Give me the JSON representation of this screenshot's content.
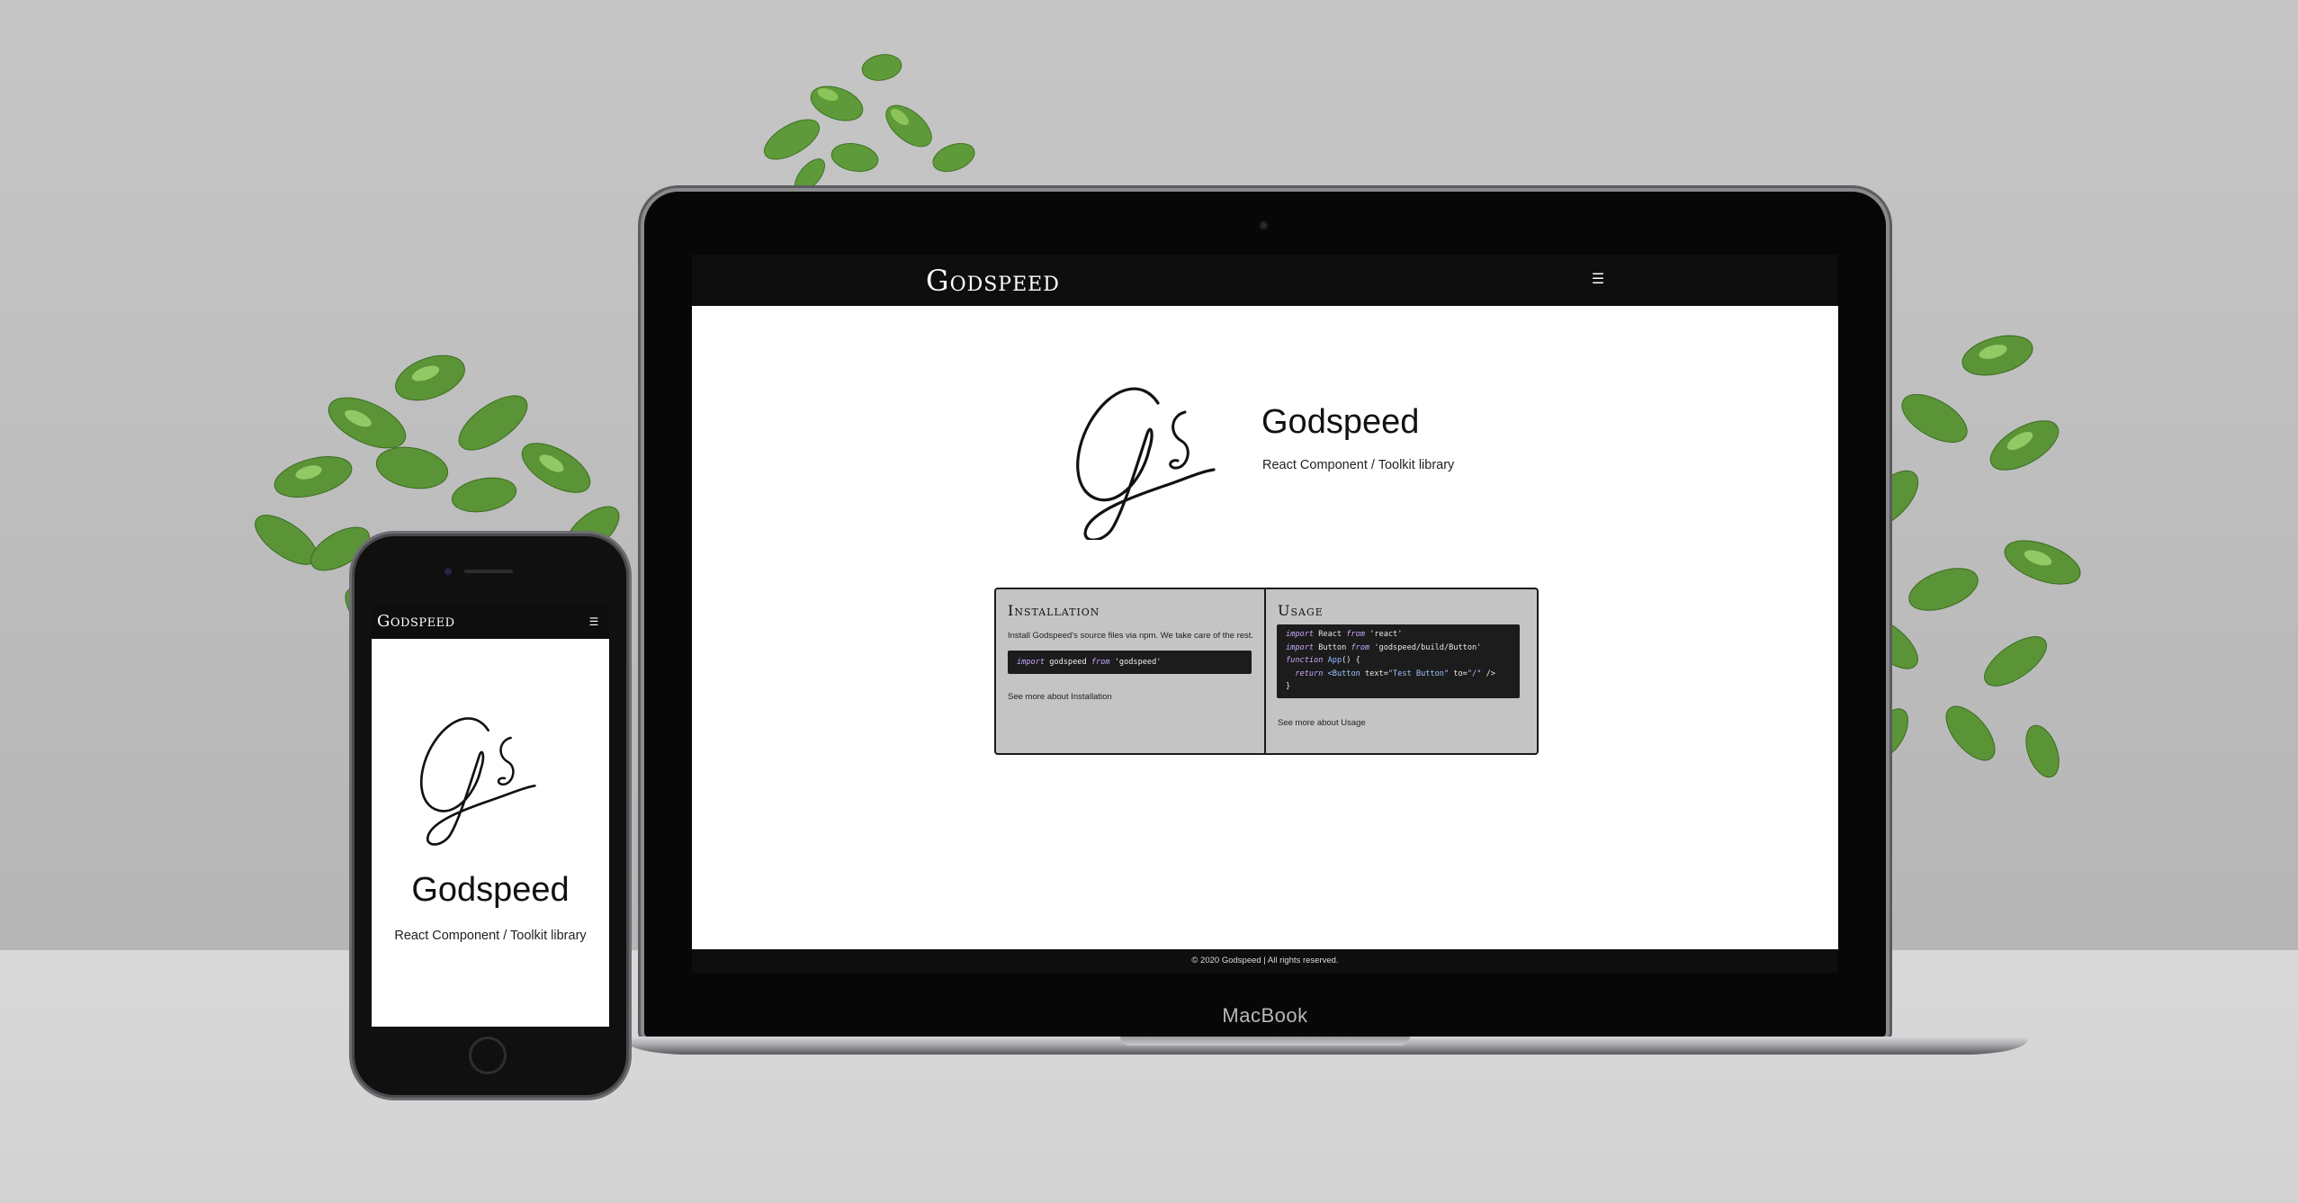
{
  "desktop": {
    "brand": "Godspeed",
    "menu_icon": "hamburger-icon",
    "logo_icon": "gs-signature-icon",
    "title": "Godspeed",
    "subtitle": "React Component / Toolkit library",
    "installation": {
      "heading": "Installation",
      "text": "Install Godspeed's source files via npm. We take care of the rest.",
      "code": {
        "kw1": "import",
        "name": "godspeed",
        "kw2": "from",
        "source": "'godspeed'"
      },
      "link": "See more about Installation"
    },
    "usage": {
      "heading": "Usage",
      "code": {
        "l1_kw1": "import",
        "l1_name": "React",
        "l1_kw2": "from",
        "l1_src": "'react'",
        "l2_kw1": "import",
        "l2_name": "Button",
        "l2_kw2": "from",
        "l2_src": "'godspeed/build/Button'",
        "l3_kw": "function",
        "l3_name": "App",
        "l3_rest": "() {",
        "l4_kw": "return",
        "l4_tag": "<Button",
        "l4_a1": "text=",
        "l4_v1": "\"Test Button\"",
        "l4_a2": "to=",
        "l4_v2": "\"/\"",
        "l4_end": "/>",
        "l5": "}"
      },
      "link": "See more about Usage"
    },
    "footer": "© 2020 Godspeed | All rights reserved.",
    "device_brand": "MacBook"
  },
  "mobile": {
    "brand": "Godspeed",
    "menu_icon": "hamburger-icon",
    "logo_icon": "gs-signature-icon",
    "title": "Godspeed",
    "subtitle": "React Component / Toolkit library"
  },
  "colors": {
    "nav_bg": "#0e0e0e",
    "card_bg": "#c4c4c4",
    "code_bg": "#1c1c1c",
    "keyword": "#c9a7ff",
    "page_bg": "#ffffff"
  }
}
